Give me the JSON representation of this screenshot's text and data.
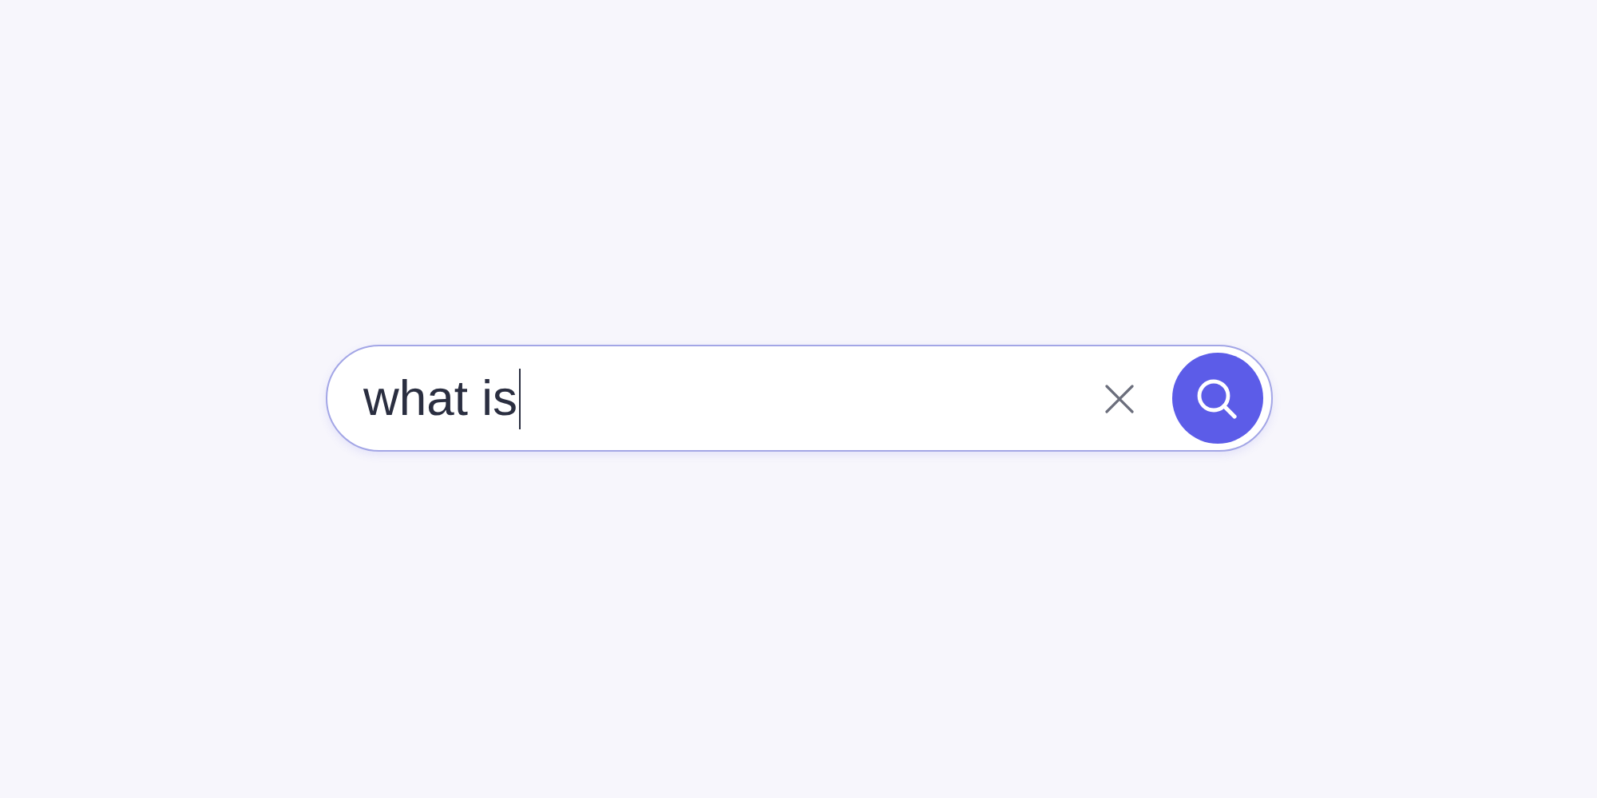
{
  "search": {
    "value": "what is",
    "focused": true
  }
}
